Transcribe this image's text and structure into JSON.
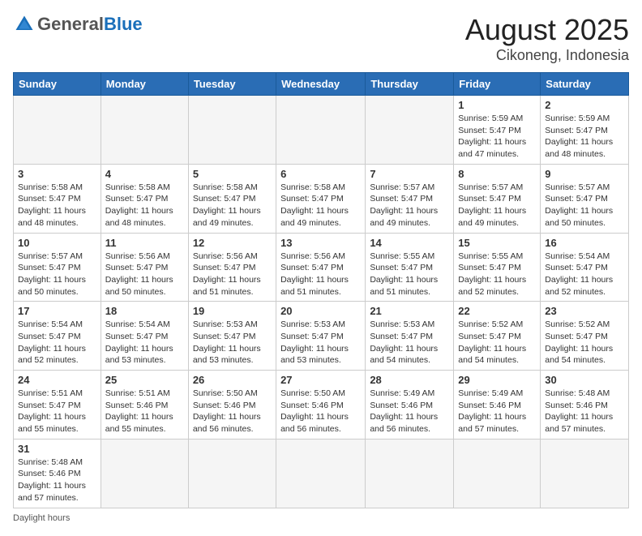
{
  "header": {
    "logo_general": "General",
    "logo_blue": "Blue",
    "month_title": "August 2025",
    "location": "Cikoneng, Indonesia"
  },
  "calendar": {
    "days_of_week": [
      "Sunday",
      "Monday",
      "Tuesday",
      "Wednesday",
      "Thursday",
      "Friday",
      "Saturday"
    ],
    "weeks": [
      [
        {
          "day": "",
          "info": ""
        },
        {
          "day": "",
          "info": ""
        },
        {
          "day": "",
          "info": ""
        },
        {
          "day": "",
          "info": ""
        },
        {
          "day": "",
          "info": ""
        },
        {
          "day": "1",
          "info": "Sunrise: 5:59 AM\nSunset: 5:47 PM\nDaylight: 11 hours and 47 minutes."
        },
        {
          "day": "2",
          "info": "Sunrise: 5:59 AM\nSunset: 5:47 PM\nDaylight: 11 hours and 48 minutes."
        }
      ],
      [
        {
          "day": "3",
          "info": "Sunrise: 5:58 AM\nSunset: 5:47 PM\nDaylight: 11 hours and 48 minutes."
        },
        {
          "day": "4",
          "info": "Sunrise: 5:58 AM\nSunset: 5:47 PM\nDaylight: 11 hours and 48 minutes."
        },
        {
          "day": "5",
          "info": "Sunrise: 5:58 AM\nSunset: 5:47 PM\nDaylight: 11 hours and 49 minutes."
        },
        {
          "day": "6",
          "info": "Sunrise: 5:58 AM\nSunset: 5:47 PM\nDaylight: 11 hours and 49 minutes."
        },
        {
          "day": "7",
          "info": "Sunrise: 5:57 AM\nSunset: 5:47 PM\nDaylight: 11 hours and 49 minutes."
        },
        {
          "day": "8",
          "info": "Sunrise: 5:57 AM\nSunset: 5:47 PM\nDaylight: 11 hours and 49 minutes."
        },
        {
          "day": "9",
          "info": "Sunrise: 5:57 AM\nSunset: 5:47 PM\nDaylight: 11 hours and 50 minutes."
        }
      ],
      [
        {
          "day": "10",
          "info": "Sunrise: 5:57 AM\nSunset: 5:47 PM\nDaylight: 11 hours and 50 minutes."
        },
        {
          "day": "11",
          "info": "Sunrise: 5:56 AM\nSunset: 5:47 PM\nDaylight: 11 hours and 50 minutes."
        },
        {
          "day": "12",
          "info": "Sunrise: 5:56 AM\nSunset: 5:47 PM\nDaylight: 11 hours and 51 minutes."
        },
        {
          "day": "13",
          "info": "Sunrise: 5:56 AM\nSunset: 5:47 PM\nDaylight: 11 hours and 51 minutes."
        },
        {
          "day": "14",
          "info": "Sunrise: 5:55 AM\nSunset: 5:47 PM\nDaylight: 11 hours and 51 minutes."
        },
        {
          "day": "15",
          "info": "Sunrise: 5:55 AM\nSunset: 5:47 PM\nDaylight: 11 hours and 52 minutes."
        },
        {
          "day": "16",
          "info": "Sunrise: 5:54 AM\nSunset: 5:47 PM\nDaylight: 11 hours and 52 minutes."
        }
      ],
      [
        {
          "day": "17",
          "info": "Sunrise: 5:54 AM\nSunset: 5:47 PM\nDaylight: 11 hours and 52 minutes."
        },
        {
          "day": "18",
          "info": "Sunrise: 5:54 AM\nSunset: 5:47 PM\nDaylight: 11 hours and 53 minutes."
        },
        {
          "day": "19",
          "info": "Sunrise: 5:53 AM\nSunset: 5:47 PM\nDaylight: 11 hours and 53 minutes."
        },
        {
          "day": "20",
          "info": "Sunrise: 5:53 AM\nSunset: 5:47 PM\nDaylight: 11 hours and 53 minutes."
        },
        {
          "day": "21",
          "info": "Sunrise: 5:53 AM\nSunset: 5:47 PM\nDaylight: 11 hours and 54 minutes."
        },
        {
          "day": "22",
          "info": "Sunrise: 5:52 AM\nSunset: 5:47 PM\nDaylight: 11 hours and 54 minutes."
        },
        {
          "day": "23",
          "info": "Sunrise: 5:52 AM\nSunset: 5:47 PM\nDaylight: 11 hours and 54 minutes."
        }
      ],
      [
        {
          "day": "24",
          "info": "Sunrise: 5:51 AM\nSunset: 5:47 PM\nDaylight: 11 hours and 55 minutes."
        },
        {
          "day": "25",
          "info": "Sunrise: 5:51 AM\nSunset: 5:46 PM\nDaylight: 11 hours and 55 minutes."
        },
        {
          "day": "26",
          "info": "Sunrise: 5:50 AM\nSunset: 5:46 PM\nDaylight: 11 hours and 56 minutes."
        },
        {
          "day": "27",
          "info": "Sunrise: 5:50 AM\nSunset: 5:46 PM\nDaylight: 11 hours and 56 minutes."
        },
        {
          "day": "28",
          "info": "Sunrise: 5:49 AM\nSunset: 5:46 PM\nDaylight: 11 hours and 56 minutes."
        },
        {
          "day": "29",
          "info": "Sunrise: 5:49 AM\nSunset: 5:46 PM\nDaylight: 11 hours and 57 minutes."
        },
        {
          "day": "30",
          "info": "Sunrise: 5:48 AM\nSunset: 5:46 PM\nDaylight: 11 hours and 57 minutes."
        }
      ],
      [
        {
          "day": "31",
          "info": "Sunrise: 5:48 AM\nSunset: 5:46 PM\nDaylight: 11 hours and 57 minutes."
        },
        {
          "day": "",
          "info": ""
        },
        {
          "day": "",
          "info": ""
        },
        {
          "day": "",
          "info": ""
        },
        {
          "day": "",
          "info": ""
        },
        {
          "day": "",
          "info": ""
        },
        {
          "day": "",
          "info": ""
        }
      ]
    ]
  },
  "footer": {
    "note": "Daylight hours"
  }
}
